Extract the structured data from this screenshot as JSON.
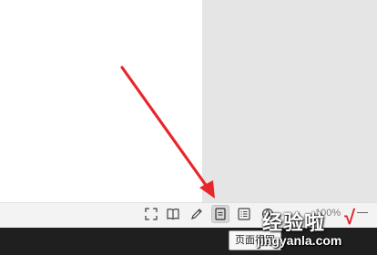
{
  "statusbar": {
    "buttons": [
      {
        "icon": "fullscreen-icon"
      },
      {
        "icon": "reading-view-icon"
      },
      {
        "icon": "pen-icon"
      },
      {
        "icon": "page-view-icon",
        "active": true
      },
      {
        "icon": "outline-view-icon"
      },
      {
        "icon": "web-view-icon"
      }
    ],
    "zoom_text": "100%",
    "tooltip": "页面视图"
  },
  "annotation": {
    "arrow_color": "#e8262c"
  },
  "watermark": {
    "title": "经验啦",
    "check": "√",
    "url": "jingyanla.com"
  },
  "colors": {
    "taskbar": "#1f1f1f",
    "statusbar": "#f3f3f3",
    "workspace": "#e6e6e6"
  }
}
